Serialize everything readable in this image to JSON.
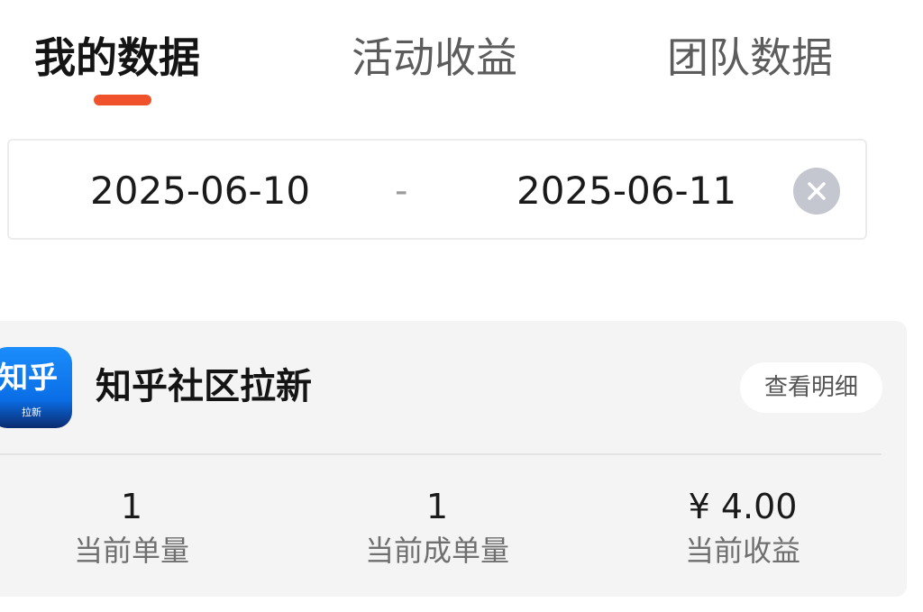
{
  "tabs": [
    {
      "label": "我的数据",
      "active": true
    },
    {
      "label": "活动收益",
      "active": false
    },
    {
      "label": "团队数据",
      "active": false
    }
  ],
  "colors": {
    "accent": "#f0522b",
    "card_bg": "#f4f4f4",
    "clear_icon_bg": "#c4c7cf",
    "logo_blue": "#0a6ee6"
  },
  "date_range": {
    "start": "2025-06-10",
    "separator": "-",
    "end": "2025-06-11",
    "clear_icon": "close-circle-icon"
  },
  "card": {
    "logo_text": "知乎",
    "logo_subtext": "拉新",
    "title": "知乎社区拉新",
    "detail_button": "查看明细",
    "stats": [
      {
        "value": "1",
        "label": "当前单量"
      },
      {
        "value": "1",
        "label": "当前成单量"
      },
      {
        "value": "¥ 4.00",
        "label": "当前收益"
      }
    ]
  }
}
